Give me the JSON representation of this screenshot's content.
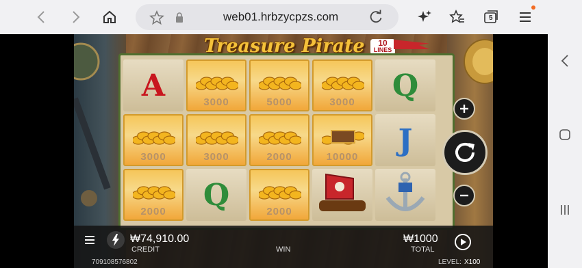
{
  "browser": {
    "url": "web01.hrbzycpzs.com",
    "tab_count": "5"
  },
  "game": {
    "title": "Treasure Pirate",
    "lines_count": "10",
    "lines_label": "LINES",
    "reels": [
      [
        {
          "kind": "letter",
          "symbol": "A",
          "color": "#c8161e"
        },
        {
          "kind": "gold",
          "value": "3000"
        },
        {
          "kind": "gold",
          "value": "2000"
        }
      ],
      [
        {
          "kind": "gold",
          "value": "3000"
        },
        {
          "kind": "gold",
          "value": "3000"
        },
        {
          "kind": "letter",
          "symbol": "Q",
          "color": "#2f8c3a"
        }
      ],
      [
        {
          "kind": "gold",
          "value": "5000"
        },
        {
          "kind": "gold",
          "value": "2000"
        },
        {
          "kind": "gold",
          "value": "2000"
        }
      ],
      [
        {
          "kind": "gold",
          "value": "3000"
        },
        {
          "kind": "chest",
          "value": "10000"
        },
        {
          "kind": "ship",
          "value": ""
        }
      ],
      [
        {
          "kind": "letter",
          "symbol": "Q",
          "color": "#2f8c3a"
        },
        {
          "kind": "letter",
          "symbol": "J",
          "color": "#2c6fc4"
        },
        {
          "kind": "anchor",
          "value": ""
        }
      ]
    ],
    "credit_value": "₩74,910.00",
    "credit_label": "CREDIT",
    "win_label": "WIN",
    "total_value": "₩1000",
    "total_label": "TOTAL",
    "session_id": "709108576802",
    "level_label": "LEVEL:",
    "level_value": "X100"
  }
}
